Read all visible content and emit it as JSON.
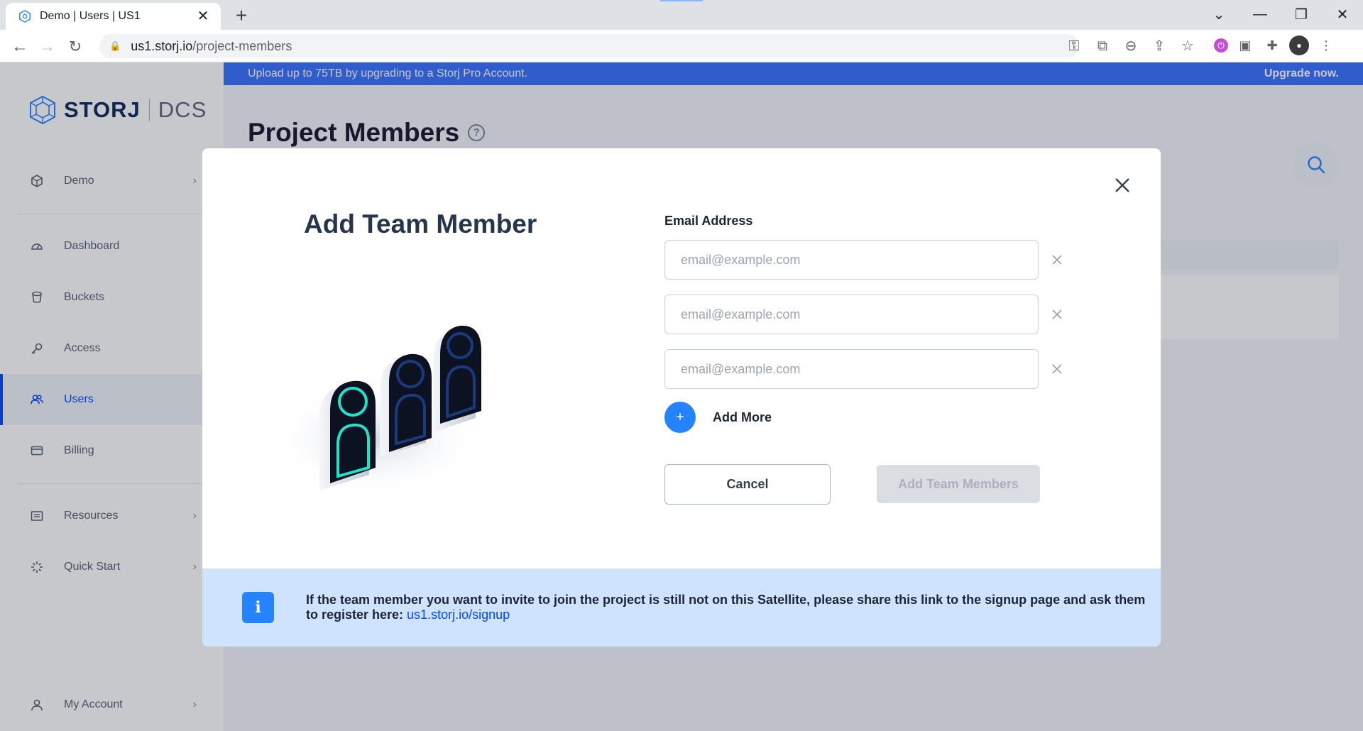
{
  "browser": {
    "tab_title": "Demo | Users | US1",
    "tab_close": "✕",
    "new_tab": "+",
    "url_host": "us1.storj.io",
    "url_path": "/project-members",
    "win_chevron": "⌄",
    "win_minimize": "—",
    "win_restore": "❐",
    "win_close": "✕"
  },
  "banner": {
    "message": "Upload up to 75TB by upgrading to a Storj Pro Account.",
    "cta": "Upgrade now."
  },
  "logo": {
    "brand": "STORJ",
    "product": "DCS"
  },
  "sidebar": {
    "project": {
      "label": "Demo",
      "icon": "box-icon"
    },
    "items": [
      {
        "label": "Dashboard",
        "icon": "gauge-icon"
      },
      {
        "label": "Buckets",
        "icon": "bucket-icon"
      },
      {
        "label": "Access",
        "icon": "key-icon"
      },
      {
        "label": "Users",
        "icon": "users-icon",
        "active": true
      },
      {
        "label": "Billing",
        "icon": "card-icon"
      }
    ],
    "resources": {
      "label": "Resources",
      "icon": "resources-icon"
    },
    "quick_start": {
      "label": "Quick Start",
      "icon": "sparkle-icon"
    },
    "account": {
      "label": "My Account",
      "icon": "user-icon"
    }
  },
  "page": {
    "title": "Project Members",
    "help": "?"
  },
  "modal": {
    "title": "Add Team Member",
    "email_label": "Email Address",
    "emails": [
      {
        "value": "",
        "placeholder": "email@example.com"
      },
      {
        "value": "",
        "placeholder": "email@example.com"
      },
      {
        "value": "",
        "placeholder": "email@example.com"
      }
    ],
    "add_more_icon": "+",
    "add_more": "Add More",
    "cancel": "Cancel",
    "submit": "Add Team Members",
    "info": {
      "icon": "i",
      "text": "If the team member you want to invite to join the project is still not on this Satellite, please share this link to the signup page and ask them to register here: ",
      "link": "us1.storj.io/signup"
    }
  },
  "colors": {
    "accent": "#0149ff",
    "button_blue": "#2683ff",
    "banner": "#376fff",
    "info_bg": "#d0e3fe"
  }
}
